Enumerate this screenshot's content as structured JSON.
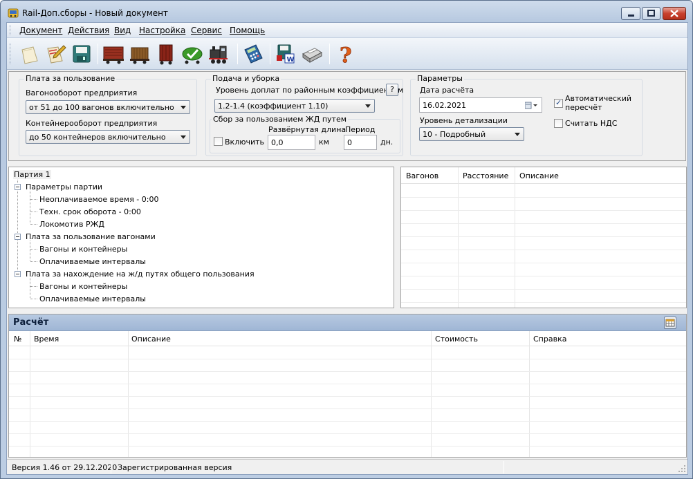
{
  "window": {
    "title": "Rail-Доп.сборы  - Новый документ"
  },
  "menu": [
    "Документ",
    "Действия",
    "Вид",
    "Настройка",
    "Сервис",
    "Помощь"
  ],
  "toolbar_icons": [
    "new-document-icon",
    "open-document-icon",
    "save-icon",
    "wagon-red-icon",
    "wagon-brown-icon",
    "tank-car-icon",
    "green-tank-check-icon",
    "locomotive-icon",
    "calculator-icon",
    "export-word-icon",
    "printer-icon",
    "help-question-icon"
  ],
  "usage_fee": {
    "group_title": "Плата за пользование",
    "wagon_turnover_label": "Вагонооборот предприятия",
    "wagon_turnover_value": "от 51 до 100 вагонов включительно",
    "container_turnover_label": "Контейнерооборот предприятия",
    "container_turnover_value": "до 50 контейнеров включительно"
  },
  "supply": {
    "group_title": "Подача и уборка",
    "surcharge_label": "Уровень доплат по районным коэффициентам",
    "help_label": "?",
    "surcharge_value": "1.2-1.4 (коэффициент 1.10)",
    "rail_fee_title": "Сбор за пользованием ЖД путем",
    "enable_label": "Включить",
    "length_label": "Развёрнутая длина",
    "length_value": "0,0",
    "length_unit": "км",
    "period_label": "Период",
    "period_value": "0",
    "period_unit": "дн."
  },
  "parameters": {
    "group_title": "Параметры",
    "date_label": "Дата расчёта",
    "date_value": "16.02.2021",
    "detail_label": "Уровень детализации",
    "detail_value": "10 - Подробный",
    "auto_recalc_label_1": "Автоматический",
    "auto_recalc_label_2": "пересчёт",
    "auto_recalc_checked": true,
    "vat_label": "Считать НДС",
    "vat_checked": false
  },
  "tree": {
    "root": "Партия 1",
    "nodes": [
      {
        "label": "Параметры партии",
        "children": [
          "Неоплачиваемое время - 0:00",
          "Техн. срок оборота  - 0:00",
          "Локомотив РЖД"
        ]
      },
      {
        "label": "Плата за пользование вагонами",
        "children": [
          "Вагоны и контейнеры",
          "Оплачиваемые интервалы"
        ]
      },
      {
        "label": "Плата за нахождение на ж/д путях общего пользования",
        "children": [
          "Вагоны и контейнеры",
          "Оплачиваемые интервалы"
        ]
      }
    ]
  },
  "right_grid": {
    "columns": [
      "Вагонов",
      "Расстояние",
      "Описание"
    ]
  },
  "calc": {
    "title": "Расчёт",
    "columns": [
      "№",
      "Время",
      "Описание",
      "Стоимость",
      "Справка"
    ]
  },
  "status": {
    "version": "Версия 1.46 от 29.12.2020",
    "registration": "Зарегистрированная версия"
  }
}
